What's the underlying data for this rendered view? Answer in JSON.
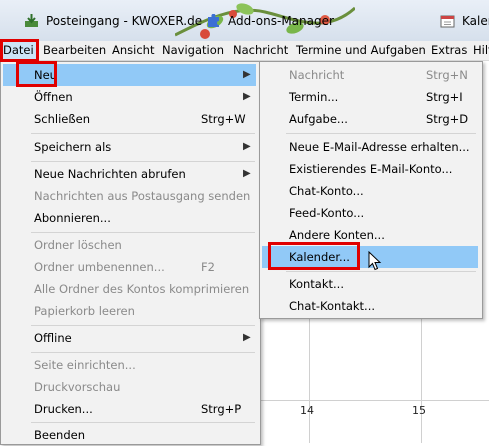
{
  "tabs": [
    {
      "label": "Posteingang - KWOXER.de",
      "icon": "inbox-download-icon"
    },
    {
      "label": "Add-ons-Manager",
      "icon": "puzzle-piece-icon"
    },
    {
      "label": "Kaler",
      "icon": "calendar-icon"
    }
  ],
  "menubar": [
    {
      "label": "Datei",
      "accel": "D"
    },
    {
      "label": "Bearbeiten",
      "accel": "B"
    },
    {
      "label": "Ansicht",
      "accel": "A"
    },
    {
      "label": "Navigation",
      "accel": "v"
    },
    {
      "label": "Nachricht",
      "accel": "N"
    },
    {
      "label": "Termine und Aufgaben",
      "accel": "T"
    },
    {
      "label": "Extras",
      "accel": "E"
    },
    {
      "label": "Hilfe",
      "accel": "H"
    }
  ],
  "file_menu": [
    {
      "label": "Neu",
      "accel": "N",
      "submenu": true,
      "state": "highlighted"
    },
    {
      "label": "Öffnen",
      "accel": "Ö",
      "submenu": true
    },
    {
      "label": "Schließen",
      "accel": "c",
      "shortcut": "Strg+W"
    },
    {
      "label": "Speichern als",
      "accel": "S",
      "submenu": true
    },
    {
      "label": "Neue Nachrichten abrufen",
      "accel": "u",
      "submenu": true
    },
    {
      "label": "Nachrichten aus Postausgang senden",
      "accel": "P",
      "disabled": true
    },
    {
      "label": "Abonnieren...",
      "accel": "A"
    },
    {
      "label": "Ordner löschen",
      "disabled": true
    },
    {
      "label": "Ordner umbenennen...",
      "accel": "u",
      "shortcut": "F2",
      "disabled": true
    },
    {
      "label": "Alle Ordner des Kontos komprimieren",
      "accel": "k",
      "disabled": true
    },
    {
      "label": "Papierkorb leeren",
      "accel": "i",
      "disabled": true
    },
    {
      "label": "Offline",
      "accel": "O",
      "submenu": true
    },
    {
      "label": "Seite einrichten...",
      "accel": "e",
      "disabled": true
    },
    {
      "label": "Druckvorschau",
      "accel": "v",
      "disabled": true
    },
    {
      "label": "Drucken...",
      "accel": "D",
      "shortcut": "Strg+P"
    },
    {
      "label": "Beenden",
      "accel": "B"
    }
  ],
  "new_submenu": [
    {
      "label": "Nachricht",
      "accel": "N",
      "shortcut": "Strg+N",
      "disabled": true
    },
    {
      "label": "Termin...",
      "accel": "T",
      "shortcut": "Strg+I"
    },
    {
      "label": "Aufgabe...",
      "accel": "f",
      "shortcut": "Strg+D"
    },
    {
      "label": "Neue E-Mail-Adresse erhalten..."
    },
    {
      "label": "Existierendes E-Mail-Konto...",
      "accel": "x"
    },
    {
      "label": "Chat-Konto...",
      "accel": "C"
    },
    {
      "label": "Feed-Konto...",
      "accel": "F"
    },
    {
      "label": "Andere Konten...",
      "accel": "A"
    },
    {
      "label": "Kalender...",
      "accel": "l",
      "state": "highlighted"
    },
    {
      "label": "Kontakt...",
      "accel": "K"
    },
    {
      "label": "Chat-Kontakt...",
      "accel": "C"
    }
  ],
  "calendar_bg": {
    "day_numbers": [
      "14",
      "15"
    ]
  },
  "colors": {
    "highlight": "#91c9f7",
    "annotation_box": "#e00000",
    "menubar_active": "#cce4f7"
  }
}
